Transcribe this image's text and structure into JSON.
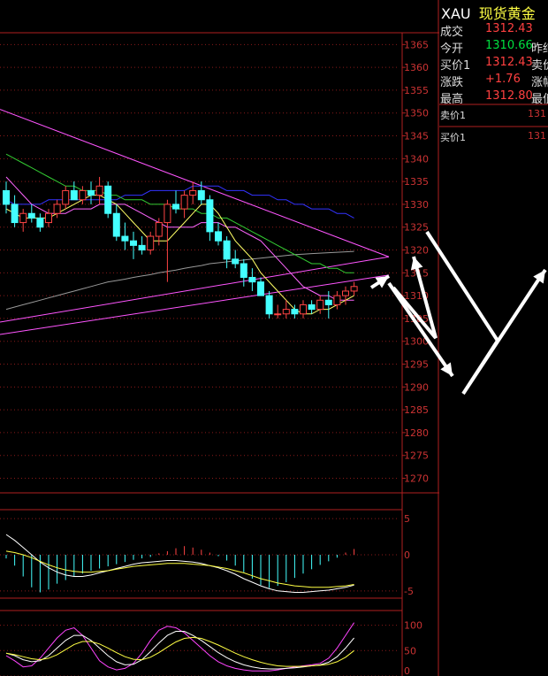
{
  "quote": {
    "symbol": "XAU",
    "name": "现货黄金",
    "rows": [
      {
        "label": "成交",
        "value": "1312.43",
        "color": "#ff4040",
        "label2": ""
      },
      {
        "label": "今开",
        "value": "1310.66",
        "color": "#00e040",
        "label2": "昨结"
      },
      {
        "label": "买价1",
        "value": "1312.43",
        "color": "#ff4040",
        "label2": "卖价"
      },
      {
        "label": "涨跌",
        "value": "+1.76",
        "color": "#ff4040",
        "label2": "涨幅"
      },
      {
        "label": "最高",
        "value": "1312.80",
        "color": "#ff4040",
        "label2": "最低"
      }
    ],
    "orderbook": [
      {
        "label": "卖价1",
        "value": "131"
      },
      {
        "label": "买价1",
        "value": "131"
      }
    ]
  },
  "colors": {
    "frame": "#b02020",
    "grid": "#8a1a1a",
    "up": "#ff4444",
    "down": "#44ffff",
    "ma5": "#ffff66",
    "ma10": "#ff66ff",
    "ma20": "#33cc33",
    "ma60": "#3333ff",
    "ma120": "#999999",
    "trendline": "#ff55ff",
    "arrow": "#ffffff"
  },
  "chart_data": [
    {
      "type": "candlestick",
      "ylim": [
        1267,
        1367
      ],
      "yticks": [
        "1365",
        "1360",
        "1355",
        "1350",
        "1345",
        "1340",
        "1335",
        "1330",
        "1325",
        "1320",
        "1315",
        "1310",
        "1305",
        "1300",
        "1295",
        "1290",
        "1285",
        "1280",
        "1275",
        "1270"
      ],
      "ohlc": [
        [
          1333,
          1335,
          1328,
          1330
        ],
        [
          1330,
          1332,
          1325,
          1326
        ],
        [
          1326,
          1329,
          1324,
          1328
        ],
        [
          1328,
          1330,
          1326,
          1327
        ],
        [
          1327,
          1328,
          1324,
          1325
        ],
        [
          1326,
          1329,
          1325,
          1328
        ],
        [
          1328,
          1331,
          1327,
          1330
        ],
        [
          1330,
          1334,
          1329,
          1333
        ],
        [
          1333,
          1335,
          1331,
          1331
        ],
        [
          1331,
          1334,
          1330,
          1333
        ],
        [
          1333,
          1335,
          1330,
          1332
        ],
        [
          1332,
          1336,
          1330,
          1334
        ],
        [
          1334,
          1335,
          1327,
          1328
        ],
        [
          1328,
          1330,
          1322,
          1323
        ],
        [
          1323,
          1326,
          1320,
          1322
        ],
        [
          1322,
          1324,
          1318,
          1321
        ],
        [
          1321,
          1323,
          1319,
          1320
        ],
        [
          1320,
          1324,
          1319,
          1323
        ],
        [
          1323,
          1327,
          1321,
          1326
        ],
        [
          1326,
          1331,
          1313,
          1330
        ],
        [
          1330,
          1333,
          1328,
          1329
        ],
        [
          1329,
          1333,
          1327,
          1332
        ],
        [
          1332,
          1335,
          1330,
          1333
        ],
        [
          1333,
          1335,
          1330,
          1331
        ],
        [
          1331,
          1332,
          1322,
          1324
        ],
        [
          1324,
          1326,
          1321,
          1322
        ],
        [
          1322,
          1323,
          1316,
          1318
        ],
        [
          1318,
          1320,
          1316,
          1317
        ],
        [
          1317,
          1318,
          1312,
          1314
        ],
        [
          1314,
          1316,
          1311,
          1313
        ],
        [
          1313,
          1314,
          1310,
          1310
        ],
        [
          1310,
          1311,
          1305,
          1306
        ],
        [
          1306,
          1308,
          1305,
          1306
        ],
        [
          1306,
          1309,
          1305,
          1307
        ],
        [
          1307,
          1308,
          1305,
          1306
        ],
        [
          1306,
          1309,
          1305,
          1308
        ],
        [
          1308,
          1309,
          1306,
          1307
        ],
        [
          1307,
          1310,
          1306,
          1309
        ],
        [
          1309,
          1311,
          1305,
          1308
        ],
        [
          1308,
          1311,
          1307,
          1310
        ],
        [
          1310,
          1312,
          1308,
          1311
        ],
        [
          1311,
          1313,
          1310,
          1312
        ]
      ],
      "ma5": [
        1329,
        1328,
        1327,
        1327,
        1327,
        1327,
        1328,
        1329,
        1330,
        1331,
        1332,
        1332,
        1331,
        1330,
        1328,
        1326,
        1324,
        1322,
        1322,
        1322,
        1324,
        1326,
        1328,
        1330,
        1330,
        1328,
        1325,
        1322,
        1320,
        1318,
        1315,
        1313,
        1311,
        1309,
        1307,
        1306,
        1306,
        1307,
        1307,
        1308,
        1309,
        1310
      ],
      "ma10": [
        1336,
        1334,
        1332,
        1330,
        1329,
        1328,
        1328,
        1328,
        1329,
        1329,
        1329,
        1330,
        1330,
        1330,
        1330,
        1329,
        1328,
        1327,
        1326,
        1325,
        1325,
        1325,
        1325,
        1326,
        1326,
        1326,
        1325,
        1325,
        1324,
        1323,
        1322,
        1320,
        1318,
        1316,
        1314,
        1312,
        1311,
        1310,
        1310,
        1309,
        1309,
        1309
      ],
      "ma20": [
        1341,
        1340,
        1339,
        1338,
        1337,
        1336,
        1335,
        1334,
        1334,
        1333,
        1333,
        1333,
        1332,
        1332,
        1331,
        1331,
        1331,
        1330,
        1330,
        1330,
        1329,
        1329,
        1329,
        1328,
        1328,
        1327,
        1327,
        1326,
        1325,
        1324,
        1323,
        1322,
        1321,
        1320,
        1319,
        1318,
        1317,
        1317,
        1316,
        1316,
        1315,
        1315
      ],
      "ma60": [
        1331,
        1330,
        1330,
        1330,
        1330,
        1331,
        1331,
        1331,
        1331,
        1331,
        1331,
        1331,
        1331,
        1331,
        1332,
        1332,
        1332,
        1333,
        1333,
        1333,
        1333,
        1333,
        1334,
        1334,
        1334,
        1334,
        1333,
        1333,
        1333,
        1332,
        1332,
        1332,
        1331,
        1331,
        1330,
        1330,
        1329,
        1329,
        1329,
        1328,
        1328,
        1327
      ],
      "ma120": [
        1307,
        1307.5,
        1308,
        1308.5,
        1309,
        1309.5,
        1310,
        1310.5,
        1311,
        1311.5,
        1312,
        1312.5,
        1313,
        1313.3,
        1313.6,
        1314,
        1314.3,
        1314.6,
        1315,
        1315.3,
        1315.6,
        1316,
        1316.3,
        1316.6,
        1317,
        1317.2,
        1317.4,
        1317.6,
        1317.8,
        1318,
        1318.2,
        1318.4,
        1318.6,
        1318.8,
        1319,
        1319.1,
        1319.2,
        1319.3,
        1319.4,
        1319.5,
        1319.6,
        1319.7
      ]
    },
    {
      "type": "bar",
      "ylim": [
        -6,
        6
      ],
      "yticks": [
        "5",
        "0",
        "-5"
      ],
      "values": [
        -0.5,
        -1.5,
        -3.0,
        -4.5,
        -5.2,
        -4.8,
        -4.0,
        -3.5,
        -3.0,
        -2.6,
        -2.2,
        -1.9,
        -1.6,
        -1.3,
        -1.0,
        -0.7,
        -0.5,
        -0.3,
        0.2,
        0.5,
        0.9,
        1.2,
        1.0,
        0.7,
        0.3,
        -0.2,
        -0.8,
        -1.5,
        -2.4,
        -3.3,
        -4.2,
        -4.6,
        -4.3,
        -3.8,
        -3.2,
        -2.6,
        -2.0,
        -1.4,
        -0.9,
        -0.4,
        0.3,
        0.8
      ],
      "dif": [
        2.8,
        2.0,
        1.0,
        0.0,
        -1.0,
        -1.8,
        -2.4,
        -2.8,
        -3.0,
        -3.0,
        -2.8,
        -2.5,
        -2.2,
        -1.9,
        -1.6,
        -1.3,
        -1.1,
        -1.0,
        -0.9,
        -0.8,
        -0.8,
        -0.9,
        -1.0,
        -1.2,
        -1.5,
        -1.8,
        -2.2,
        -2.7,
        -3.3,
        -3.8,
        -4.3,
        -4.7,
        -5.0,
        -5.1,
        -5.2,
        -5.2,
        -5.1,
        -5.0,
        -4.9,
        -4.7,
        -4.5,
        -4.2
      ],
      "dea": [
        0.5,
        0.3,
        0.0,
        -0.4,
        -0.9,
        -1.4,
        -1.8,
        -2.1,
        -2.3,
        -2.4,
        -2.4,
        -2.3,
        -2.2,
        -2.0,
        -1.8,
        -1.6,
        -1.5,
        -1.4,
        -1.3,
        -1.2,
        -1.2,
        -1.2,
        -1.3,
        -1.4,
        -1.5,
        -1.7,
        -1.9,
        -2.2,
        -2.5,
        -2.9,
        -3.3,
        -3.6,
        -3.9,
        -4.1,
        -4.3,
        -4.4,
        -4.5,
        -4.5,
        -4.5,
        -4.4,
        -4.3,
        -4.1
      ]
    },
    {
      "type": "line",
      "ylim": [
        0,
        115
      ],
      "yticks": [
        "100",
        "50",
        "0"
      ],
      "series": [
        {
          "color": "#ff44ff",
          "values": [
            40,
            30,
            18,
            20,
            35,
            55,
            75,
            90,
            95,
            80,
            55,
            30,
            18,
            12,
            15,
            25,
            45,
            70,
            90,
            98,
            95,
            85,
            70,
            55,
            40,
            28,
            20,
            15,
            12,
            10,
            10,
            10,
            12,
            15,
            18,
            20,
            22,
            25,
            35,
            55,
            80,
            105
          ]
        },
        {
          "color": "#ffffff",
          "values": [
            45,
            40,
            32,
            28,
            30,
            40,
            55,
            70,
            80,
            80,
            70,
            55,
            40,
            28,
            22,
            23,
            32,
            48,
            65,
            80,
            88,
            88,
            80,
            70,
            58,
            46,
            36,
            28,
            22,
            18,
            15,
            14,
            14,
            15,
            16,
            18,
            20,
            22,
            27,
            38,
            55,
            75
          ]
        },
        {
          "color": "#ffff44",
          "values": [
            45,
            42,
            38,
            34,
            32,
            35,
            42,
            52,
            62,
            68,
            68,
            63,
            55,
            46,
            38,
            33,
            32,
            37,
            46,
            57,
            67,
            74,
            76,
            74,
            68,
            61,
            53,
            45,
            38,
            32,
            27,
            23,
            20,
            19,
            19,
            19,
            20,
            21,
            23,
            28,
            37,
            50
          ]
        }
      ]
    }
  ]
}
